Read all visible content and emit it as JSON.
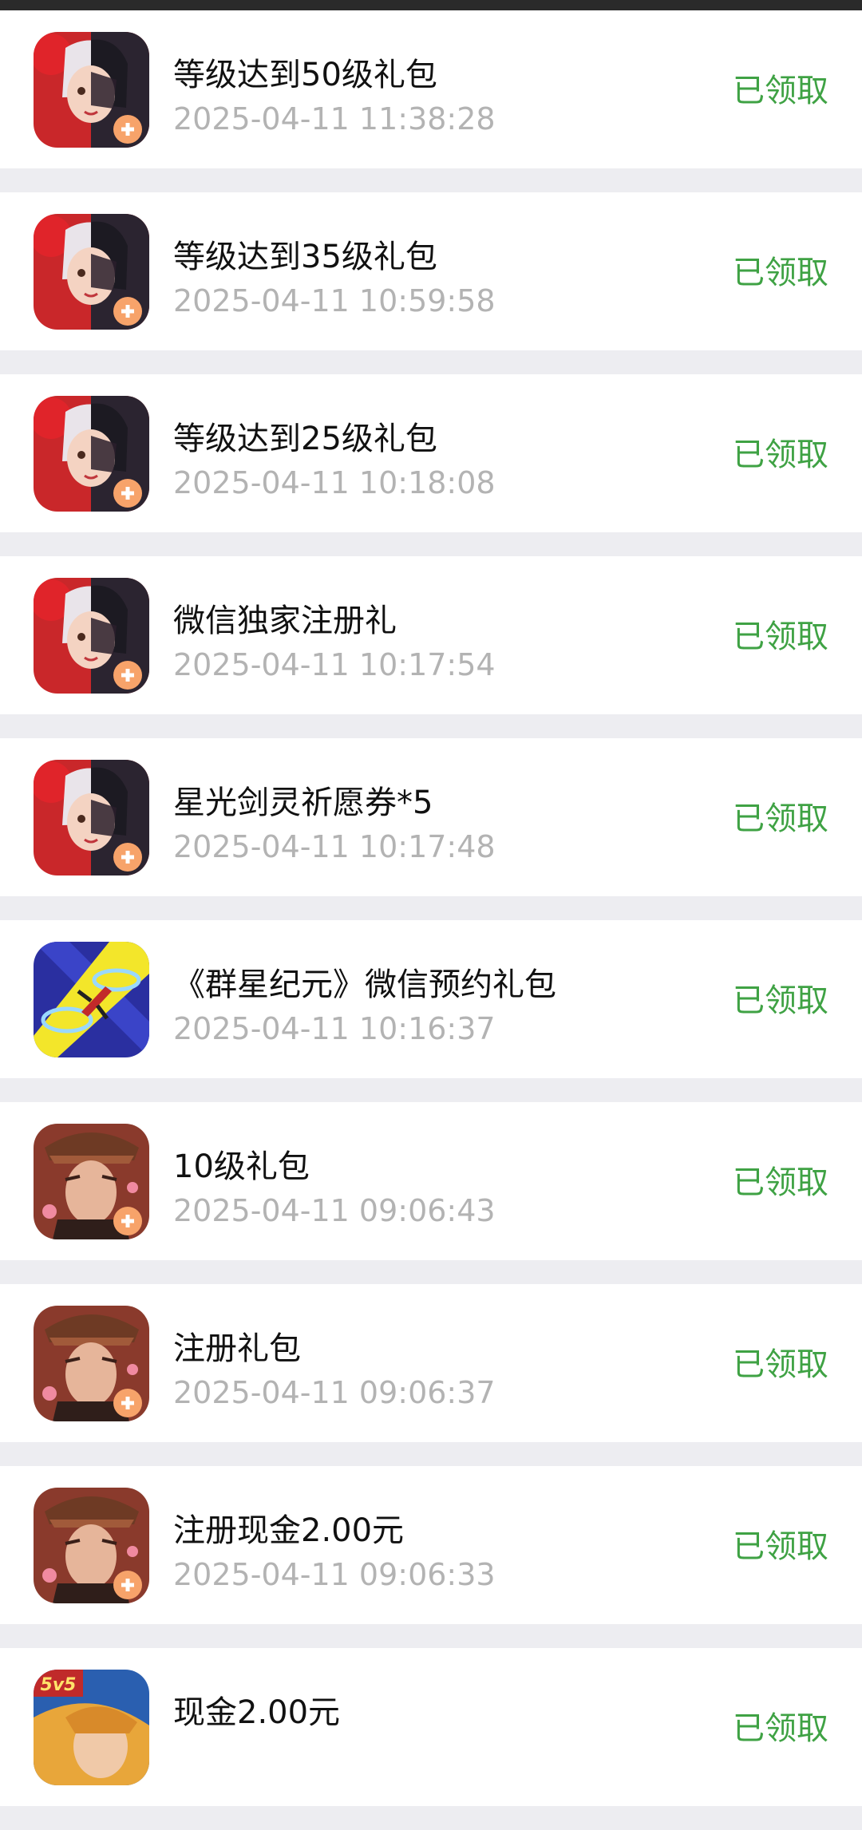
{
  "colors": {
    "status_green": "#3fa244",
    "background": "#ededf1",
    "card": "#ffffff",
    "title": "#111111",
    "time": "#b3b3b3"
  },
  "items": [
    {
      "title": "等级达到50级礼包",
      "time": "2025-04-11 11:38:28",
      "status": "已领取",
      "icon": "anime-girl-game-icon"
    },
    {
      "title": "等级达到35级礼包",
      "time": "2025-04-11 10:59:58",
      "status": "已领取",
      "icon": "anime-girl-game-icon"
    },
    {
      "title": "等级达到25级礼包",
      "time": "2025-04-11 10:18:08",
      "status": "已领取",
      "icon": "anime-girl-game-icon"
    },
    {
      "title": "微信独家注册礼",
      "time": "2025-04-11 10:17:54",
      "status": "已领取",
      "icon": "anime-girl-game-icon"
    },
    {
      "title": "星光剑灵祈愿券*5",
      "time": "2025-04-11 10:17:48",
      "status": "已领取",
      "icon": "anime-girl-game-icon"
    },
    {
      "title": "《群星纪元》微信预约礼包",
      "time": "2025-04-11 10:16:37",
      "status": "已领取",
      "icon": "spaceship-game-icon"
    },
    {
      "title": "10级礼包",
      "time": "2025-04-11 09:06:43",
      "status": "已领取",
      "icon": "warrior-game-icon"
    },
    {
      "title": "注册礼包",
      "time": "2025-04-11 09:06:37",
      "status": "已领取",
      "icon": "warrior-game-icon"
    },
    {
      "title": "注册现金2.00元",
      "time": "2025-04-11 09:06:33",
      "status": "已领取",
      "icon": "warrior-game-icon"
    },
    {
      "title": "现金2.00元",
      "time": "",
      "status": "已领取",
      "icon": "5v5-game-icon",
      "icon_badge": "5v5"
    }
  ]
}
